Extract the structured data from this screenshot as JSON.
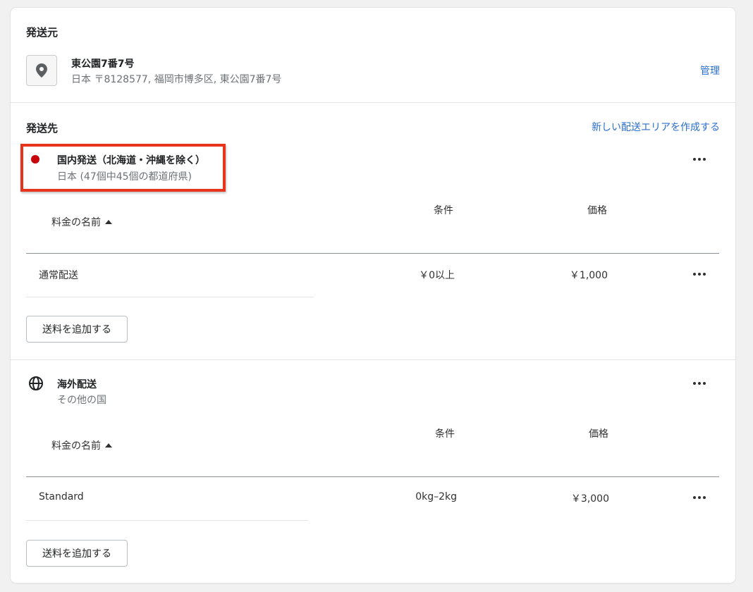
{
  "origin": {
    "heading": "発送元",
    "location_name": "東公園7番7号",
    "location_address": "日本 〒8128577, 福岡市博多区, 東公園7番7号",
    "manage_link": "管理",
    "icon": "location-pin-icon"
  },
  "destinations": {
    "heading": "発送先",
    "create_zone_link": "新しい配送エリアを作成する",
    "zones": [
      {
        "name": "国内発送（北海道・沖縄を除く）",
        "subtitle": "日本 (47個中45個の都道府県)",
        "icon": "red-dot",
        "icon_color": "#c8000a",
        "col_rate_name": "料金の名前",
        "col_condition": "条件",
        "col_price": "価格",
        "rates": [
          {
            "name": "通常配送",
            "condition": "￥0以上",
            "price": "￥1,000"
          }
        ],
        "add_rate_button": "送料を追加する"
      },
      {
        "name": "海外配送",
        "subtitle": "その他の国",
        "icon": "globe-icon",
        "col_rate_name": "料金の名前",
        "col_condition": "条件",
        "col_price": "価格",
        "rates": [
          {
            "name": "Standard",
            "condition": "0kg–2kg",
            "price": "￥3,000"
          }
        ],
        "add_rate_button": "送料を追加する"
      }
    ]
  },
  "colors": {
    "link": "#2c6ecb",
    "highlight_border": "#e8341c"
  }
}
